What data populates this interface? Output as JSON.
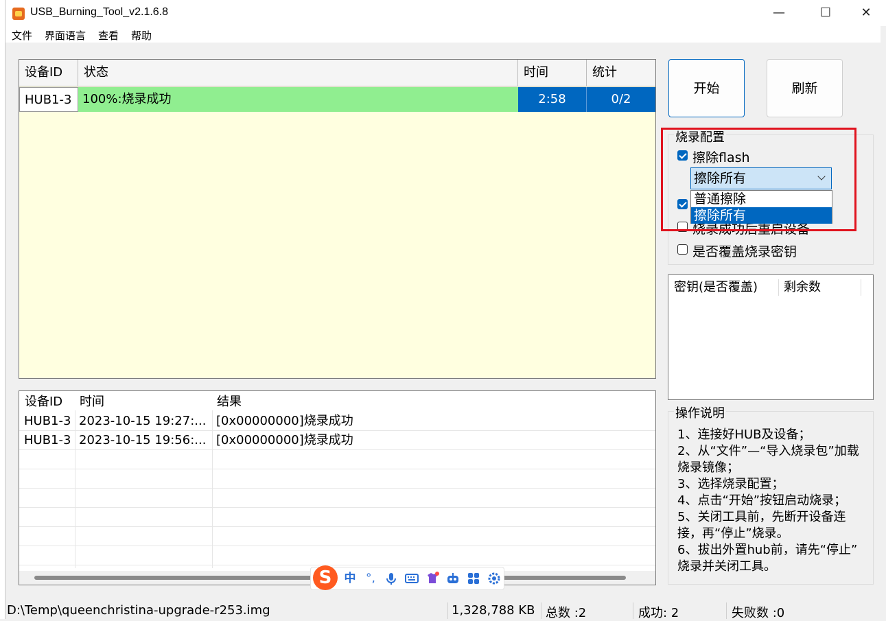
{
  "window": {
    "title": "USB_Burning_Tool_v2.1.6.8",
    "minimize": "—",
    "maximize": "☐",
    "close": "✕"
  },
  "menu": [
    "文件",
    "界面语言",
    "查看",
    "帮助"
  ],
  "main_table": {
    "headers": [
      "设备ID",
      "状态",
      "时间",
      "统计"
    ],
    "row": {
      "device_id": "HUB1-3",
      "status": "100%:烧录成功",
      "time": "2:58",
      "stats": "0/2"
    }
  },
  "buttons": {
    "start": "开始",
    "refresh": "刷新"
  },
  "config": {
    "title": "烧录配置",
    "erase_flash": {
      "label": "擦除flash",
      "checked": true
    },
    "erase_mode": {
      "value": "擦除所有",
      "options": [
        "普通擦除",
        "擦除所有"
      ],
      "selected_index": 1
    },
    "reboot_after": {
      "label": "烧录成功后重启设备",
      "checked": false
    },
    "overwrite_key": {
      "label": "是否覆盖烧录密钥",
      "checked": false
    }
  },
  "key_list": {
    "headers": [
      "密钥(是否覆盖)",
      "剩余数"
    ]
  },
  "help": {
    "title": "操作说明",
    "lines": [
      "1、连接好HUB及设备；",
      "2、从“文件”—“导入烧录包”加载",
      "烧录镜像；",
      "3、选择烧录配置；",
      "4、点击“开始”按钮启动烧录；",
      "5、关闭工具前，先断开设备连",
      "接，再“停止”烧录。",
      "6、拔出外置hub前，请先“停止”",
      "烧录并关闭工具。"
    ]
  },
  "log_table": {
    "headers": [
      "设备ID",
      "时间",
      "结果"
    ],
    "rows": [
      {
        "device_id": "HUB1-3",
        "time": "2023-10-15 19:27:...",
        "result": "[0x00000000]烧录成功"
      },
      {
        "device_id": "HUB1-3",
        "time": "2023-10-15 19:56:...",
        "result": "[0x00000000]烧录成功"
      }
    ]
  },
  "status_bar": {
    "path": "D:\\Temp\\queenchristina-upgrade-r253.img",
    "size": "1,328,788 KB",
    "total": "总数 :2",
    "success": "成功:  2",
    "failed": "失败数 :0"
  },
  "ime": {
    "logo": "S",
    "mode": "中",
    "punct": "°,",
    "icons": [
      "mic-icon",
      "keyboard-icon",
      "skin-icon",
      "robot-icon",
      "apps-icon",
      "settings-icon"
    ]
  },
  "colors": {
    "accent": "#0067c0",
    "status_success": "#90ee90",
    "table_bg": "#ffffe0",
    "highlight_box": "#e0131e"
  }
}
